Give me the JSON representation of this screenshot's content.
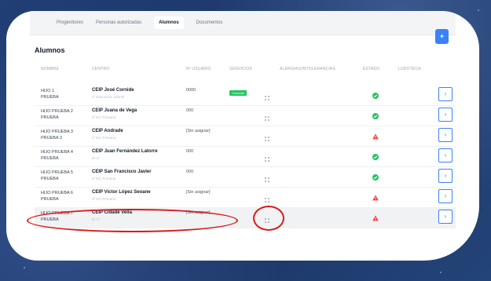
{
  "tabs": [
    {
      "label": "Progenitores",
      "active": false
    },
    {
      "label": "Personas autorizadas",
      "active": false
    },
    {
      "label": "Alumnos",
      "active": true
    },
    {
      "label": "Documentos",
      "active": false
    }
  ],
  "section": {
    "title": "Alumnos",
    "add_label": "+"
  },
  "columns": [
    "NOMBRE",
    "CENTRO",
    "Nº USUARIO",
    "SERVICIOS",
    "ALERGIAS/INTOLERANCIAS",
    "ESTADO",
    "LUDOTECA"
  ],
  "rows": [
    {
      "name1": "HIJO 1",
      "name2": "PRUEBA",
      "centro": "CEIP José Cornide",
      "curso": "4º Educación Infantil",
      "usuario": "0000",
      "servicio": "Comedor",
      "estado": "ok"
    },
    {
      "name1": "HIJO PRUEBA 2",
      "name2": "PRUEBA",
      "centro": "CEIP Juana de Vega",
      "curso": "3º Ed. Primaria",
      "usuario": "000",
      "servicio": "",
      "estado": "ok"
    },
    {
      "name1": "HIJO PRUEBA 3",
      "name2": "PRUEBA 3",
      "centro": "CEIP Andrade",
      "curso": "1º Ed. Primaria",
      "usuario": "[Sin asignar]",
      "servicio": "",
      "estado": "warning"
    },
    {
      "name1": "HIJO PRUEBA 4",
      "name2": "PRUEBA",
      "centro": "CEIP Juan Fernández Latorre",
      "curso": "EI 4º",
      "usuario": "000",
      "servicio": "",
      "estado": "ok"
    },
    {
      "name1": "HIJO PRUEBA 5",
      "name2": "PRUEBA",
      "centro": "CEIP San Francisco Javier",
      "curso": "3º Ed. Primaria",
      "usuario": "000",
      "servicio": "",
      "estado": "ok"
    },
    {
      "name1": "HIJO PRUEBA 6",
      "name2": "PRUEBA",
      "centro": "CEIP Víctor López Seoane",
      "curso": "3º Ed. Primaria",
      "usuario": "[Sin asignar]",
      "servicio": "",
      "estado": "warning"
    },
    {
      "name1": "HIJO PRUEBA 7",
      "name2": "PRUEBA",
      "centro": "CEIP Cidade Vella",
      "curso": "EI 4º",
      "usuario": "[Sin asignar]",
      "servicio": "",
      "estado": "warning"
    }
  ],
  "colors": {
    "accent": "#3b82f6",
    "ok": "#22c55e",
    "warning": "#ef4444",
    "annotation": "#d91c1c",
    "background": "#1f3b6e"
  },
  "icons": {
    "add": "plus-icon",
    "grid": "grid-dots-icon",
    "ok": "check-circle-icon",
    "warning": "warning-triangle-icon",
    "action": "chevron-right-icon"
  }
}
